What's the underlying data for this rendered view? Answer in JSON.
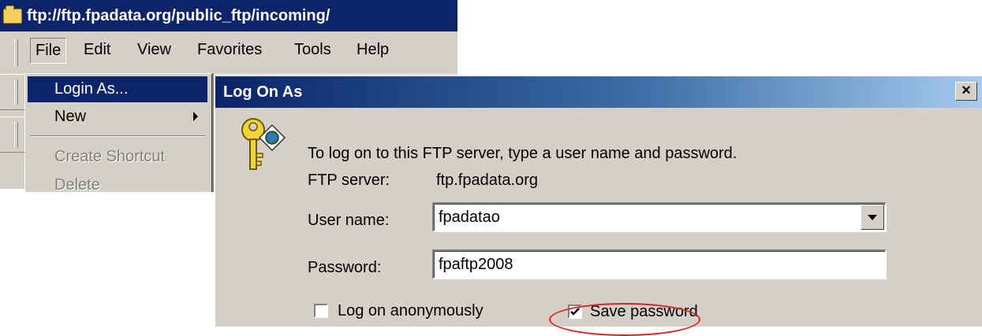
{
  "window": {
    "title": "ftp://ftp.fpadata.org/public_ftp/incoming/"
  },
  "menubar": {
    "items": [
      "File",
      "Edit",
      "View",
      "Favorites",
      "Tools",
      "Help"
    ]
  },
  "file_menu": {
    "items": [
      {
        "label": "Login As...",
        "state": "selected"
      },
      {
        "label": "New",
        "state": "normal",
        "submenu": true
      },
      {
        "label": "Create Shortcut",
        "state": "disabled"
      },
      {
        "label": "Delete",
        "state": "disabled"
      }
    ]
  },
  "dialog": {
    "title": "Log On As",
    "close_label": "×",
    "intro": "To log on to this FTP server, type a user name and password.",
    "server_label": "FTP server:",
    "server_value": "ftp.fpadata.org",
    "username_label": "User name:",
    "username_value": "fpadatao",
    "password_label": "Password:",
    "password_value": "fpaftp2008",
    "anonymous_label": "Log on anonymously",
    "anonymous_checked": false,
    "save_password_label": "Save password",
    "save_password_checked": true,
    "highlight_color": "#e02020"
  },
  "colors": {
    "titlebar": "#0b246a",
    "face": "#d4d0c8",
    "selection": "#0b246a"
  }
}
